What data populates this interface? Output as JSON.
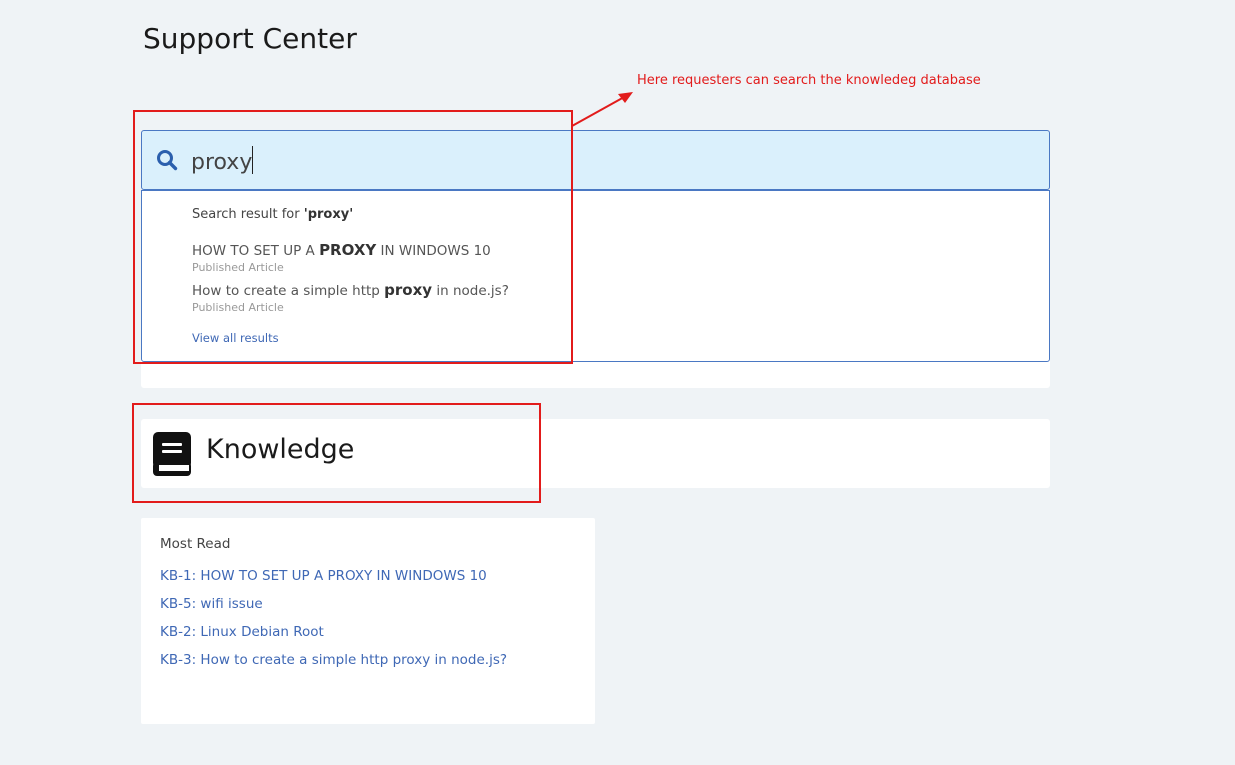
{
  "page": {
    "title": "Support Center"
  },
  "annotation": {
    "text": "Here requesters can search the knowledeg database",
    "color": "#e21b1b"
  },
  "search": {
    "value": "proxy",
    "dropdown": {
      "result_prefix": "Search result for ",
      "result_query": "'proxy'",
      "results": [
        {
          "pre": "HOW TO SET UP A ",
          "match": "PROXY",
          "post": " IN WINDOWS 10",
          "status": "Published Article"
        },
        {
          "pre": "How to create a simple http ",
          "match": "proxy",
          "post": " in node.js?",
          "status": "Published Article"
        }
      ],
      "view_all": "View all results"
    }
  },
  "knowledge": {
    "title": "Knowledge",
    "icon": "book-icon"
  },
  "most_read": {
    "title": "Most Read",
    "items": [
      "KB-1: HOW TO SET UP A PROXY IN WINDOWS 10",
      "KB-5: wifi issue",
      "KB-2: Linux Debian Root",
      "KB-3: How to create a simple http proxy in node.js?"
    ]
  },
  "colors": {
    "accent": "#3f68b5",
    "search_bg": "#daf0fc",
    "page_bg": "#eff3f6"
  }
}
